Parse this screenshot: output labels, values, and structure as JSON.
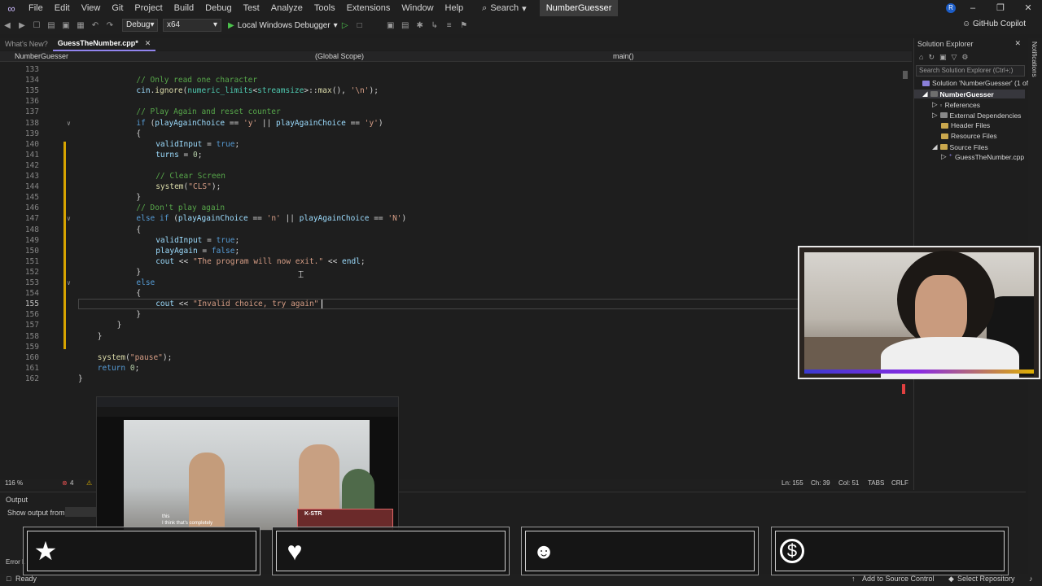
{
  "menubar": {
    "items": [
      "File",
      "Edit",
      "View",
      "Git",
      "Project",
      "Build",
      "Debug",
      "Test",
      "Analyze",
      "Tools",
      "Extensions",
      "Window",
      "Help"
    ],
    "search_label": "Search",
    "project_name": "NumberGuesser",
    "avatar_initial": "R"
  },
  "toolbar": {
    "config": "Debug",
    "platform": "x64",
    "run_label": "Local Windows Debugger",
    "copilot": "GitHub Copilot"
  },
  "tabs": [
    {
      "label": "What's New?",
      "active": false
    },
    {
      "label": "GuessTheNumber.cpp*",
      "active": true
    }
  ],
  "navbar": {
    "project": "NumberGuesser",
    "scope": "(Global Scope)",
    "function": "main()"
  },
  "editor": {
    "lines": [
      {
        "n": "133",
        "code": ""
      },
      {
        "n": "134",
        "code": "// Only read one character"
      },
      {
        "n": "135",
        "code": "cin.ignore(numeric_limits<streamsize>::max(), '\\n');"
      },
      {
        "n": "136",
        "code": ""
      },
      {
        "n": "137",
        "code": "// Play Again and reset counter"
      },
      {
        "n": "138",
        "code": "if (playAgainChoice == 'y' || playAgainChoice == 'y')"
      },
      {
        "n": "139",
        "code": "{"
      },
      {
        "n": "140",
        "code": "validInput = true;"
      },
      {
        "n": "141",
        "code": "turns = 0;"
      },
      {
        "n": "142",
        "code": ""
      },
      {
        "n": "143",
        "code": "// Clear Screen"
      },
      {
        "n": "144",
        "code": "system(\"CLS\");"
      },
      {
        "n": "145",
        "code": "}"
      },
      {
        "n": "146",
        "code": "// Don't play again"
      },
      {
        "n": "147",
        "code": "else if (playAgainChoice == 'n' || playAgainChoice == 'N')"
      },
      {
        "n": "148",
        "code": "{"
      },
      {
        "n": "149",
        "code": "validInput = true;"
      },
      {
        "n": "150",
        "code": "playAgain = false;"
      },
      {
        "n": "151",
        "code": "cout << \"The program will now exit.\" << endl;"
      },
      {
        "n": "152",
        "code": "}"
      },
      {
        "n": "153",
        "code": "else"
      },
      {
        "n": "154",
        "code": "{"
      },
      {
        "n": "155",
        "code": "cout << \"Invalid choice, try again\""
      },
      {
        "n": "156",
        "code": "}"
      },
      {
        "n": "157",
        "code": "}"
      },
      {
        "n": "158",
        "code": "}"
      },
      {
        "n": "159",
        "code": ""
      },
      {
        "n": "160",
        "code": "system(\"pause\");"
      },
      {
        "n": "161",
        "code": "return 0;"
      },
      {
        "n": "162",
        "code": "}"
      }
    ],
    "current_line": "155"
  },
  "editor_status": {
    "zoom": "116 %",
    "errors": "4",
    "ln": "Ln: 155",
    "ch": "Ch: 39",
    "col": "Col: 51",
    "tabs": "TABS",
    "eol": "CRLF"
  },
  "output": {
    "title": "Output",
    "show_from": "Show output from:",
    "error_list": "Error L"
  },
  "statusbar": {
    "ready": "Ready",
    "source_control": "Add to Source Control",
    "repo": "Select Repository"
  },
  "solution_explorer": {
    "title": "Solution Explorer",
    "search_placeholder": "Search Solution Explorer (Ctrl+;)",
    "items": [
      {
        "label": "Solution 'NumberGuesser' (1 of 1 project)"
      },
      {
        "label": "NumberGuesser"
      },
      {
        "label": "References"
      },
      {
        "label": "External Dependencies"
      },
      {
        "label": "Header Files"
      },
      {
        "label": "Resource Files"
      },
      {
        "label": "Source Files"
      },
      {
        "label": "GuessTheNumber.cpp"
      }
    ]
  },
  "notifications_label": "Notifications",
  "pip": {
    "caption1": "this",
    "caption2": "I think that's completely",
    "badge": "K-STR"
  },
  "icons": {
    "card1": "star-icon",
    "card2": "heart-icon",
    "card3": "add-user-icon",
    "card4": "dollar-icon"
  }
}
